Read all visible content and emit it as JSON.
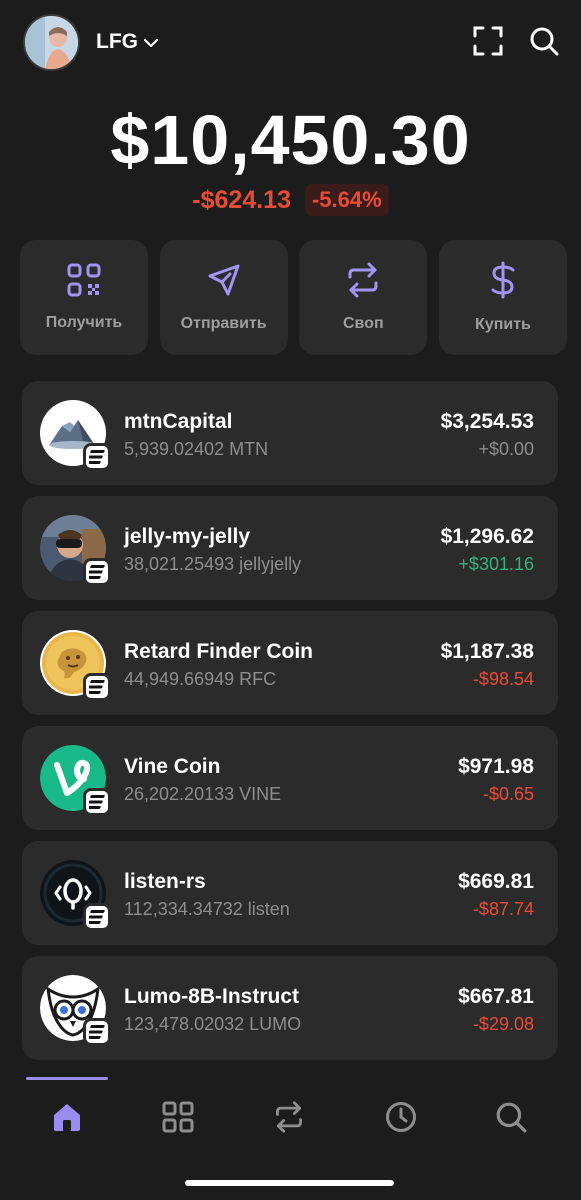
{
  "header": {
    "account_name": "LFG",
    "icons": [
      "scan-icon",
      "search-icon"
    ]
  },
  "portfolio": {
    "balance": "$10,450.30",
    "change_amount": "-$624.13",
    "change_percent": "-5.64%"
  },
  "actions": [
    {
      "label": "Получить",
      "icon": "qr-code-icon"
    },
    {
      "label": "Отправить",
      "icon": "send-icon"
    },
    {
      "label": "Своп",
      "icon": "swap-icon"
    },
    {
      "label": "Купить",
      "icon": "dollar-icon"
    }
  ],
  "tokens": [
    {
      "name": "mtnCapital",
      "balance": "5,939.02402 MTN",
      "value": "$3,254.53",
      "change": "+$0.00",
      "trend": "neutral"
    },
    {
      "name": "jelly-my-jelly",
      "balance": "38,021.25493 jellyjelly",
      "value": "$1,296.62",
      "change": "+$301.16",
      "trend": "up"
    },
    {
      "name": "Retard Finder Coin",
      "balance": "44,949.66949 RFC",
      "value": "$1,187.38",
      "change": "-$98.54",
      "trend": "down"
    },
    {
      "name": "Vine Coin",
      "balance": "26,202.20133 VINE",
      "value": "$971.98",
      "change": "-$0.65",
      "trend": "down"
    },
    {
      "name": "listen-rs",
      "balance": "112,334.34732 listen",
      "value": "$669.81",
      "change": "-$87.74",
      "trend": "down"
    },
    {
      "name": "Lumo-8B-Instruct",
      "balance": "123,478.02032 LUMO",
      "value": "$667.81",
      "change": "-$29.08",
      "trend": "down"
    }
  ],
  "bottom_nav": {
    "items": [
      "home-icon",
      "grid-icon",
      "swap-icon",
      "history-icon",
      "search-icon"
    ],
    "active": "home-icon"
  },
  "colors": {
    "background": "#1c1c1c",
    "card": "#2b2b2b",
    "accent": "#9a8cf0",
    "negative": "#ea4b35",
    "positive": "#2fb37a",
    "neutral": "#8e8e8e"
  }
}
